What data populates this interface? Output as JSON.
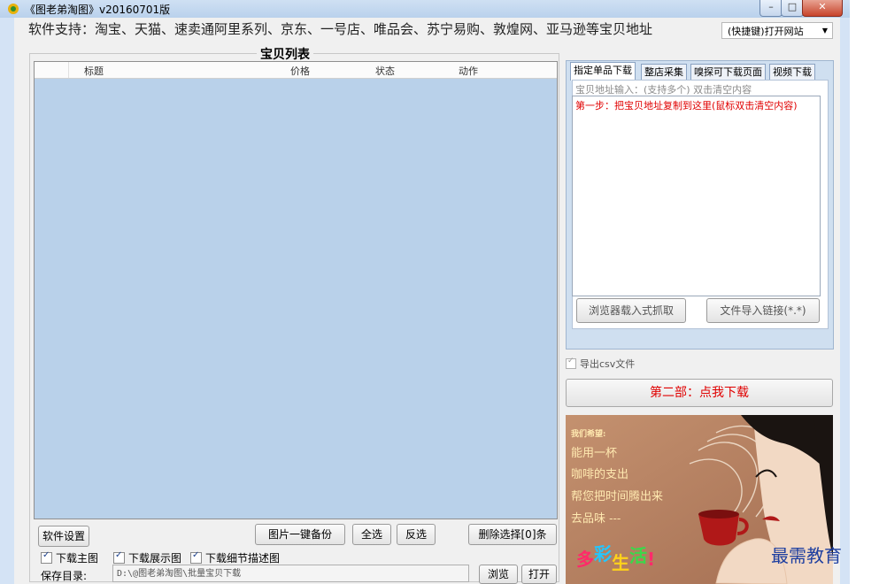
{
  "window": {
    "title": "《图老弟淘图》v20160701版"
  },
  "support_text": "软件支持：淘宝、天猫、速卖通阿里系列、京东、一号店、唯品会、苏宁易购、敦煌网、亚马逊等宝贝地址",
  "shortcut_select": {
    "value": "(快捷键)打开网站"
  },
  "product_list": {
    "title": "宝贝列表",
    "columns": [
      "标题",
      "价格",
      "状态",
      "动作"
    ]
  },
  "buttons": {
    "settings": "软件设置",
    "image_backup": "图片一键备份",
    "select_all": "全选",
    "invert": "反选",
    "delete_selected": "删除选择[0]条",
    "browse": "浏览",
    "open": "打开",
    "browser_load": "浏览器载入式抓取",
    "file_import": "文件导入链接(*.*)",
    "download_main": "第二部：点我下载"
  },
  "checkboxes": [
    {
      "label": "下载主图",
      "checked": true
    },
    {
      "label": "下载展示图",
      "checked": true
    },
    {
      "label": "下载细节描述图",
      "checked": true
    }
  ],
  "save_dir": {
    "label": "保存目录:",
    "value": "D:\\@图老弟淘图\\批量宝贝下载"
  },
  "tabs": [
    {
      "label": "指定单品下载",
      "active": true
    },
    {
      "label": "整店采集",
      "active": false
    },
    {
      "label": "嗅探可下载页面",
      "active": false
    },
    {
      "label": "视频下载",
      "active": false
    }
  ],
  "url_input": {
    "hint": "宝贝地址输入：(支持多个) 双击清空内容",
    "placeholder": "第一步：把宝贝地址复制到这里(鼠标双击清空内容)"
  },
  "export_csv": {
    "label": "导出csv文件",
    "checked": true
  },
  "ad": {
    "header": "我们希望:",
    "lines": [
      "能用一杯",
      "咖啡的支出",
      "帮您把时间腾出来",
      "去品味 ---"
    ],
    "slogan": [
      "多",
      "彩",
      "生",
      "活",
      "!"
    ]
  },
  "watermark": "最需教育",
  "colors": {
    "list_bg": "#b9d1ea",
    "accent_red": "#e00000",
    "ad_bg": "#b88263",
    "slogan": [
      "#ff2a6a",
      "#22c7ff",
      "#ffd21a",
      "#3bd84a",
      "#ff2a6a"
    ]
  }
}
